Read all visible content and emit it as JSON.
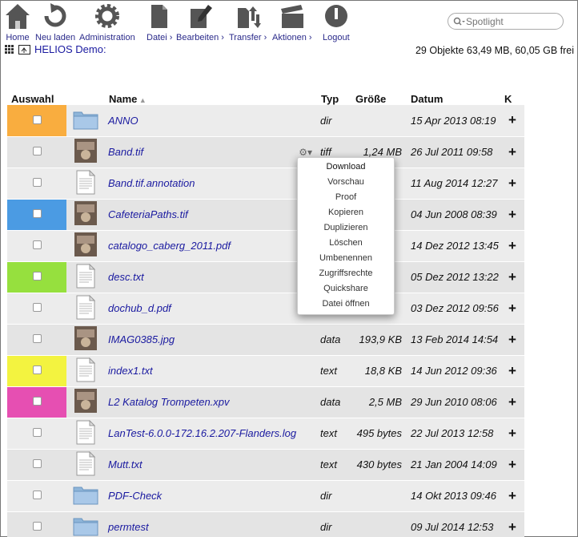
{
  "toolbar": {
    "home": "Home",
    "reload": "Neu laden",
    "admin": "Administration",
    "file": "Datei ›",
    "edit": "Bearbeiten ›",
    "transfer": "Transfer ›",
    "actions": "Aktionen ›",
    "logout": "Logout",
    "spotlight_placeholder": "Spotlight"
  },
  "pathbar": {
    "path": "HELIOS Demo:",
    "info": "29 Objekte 63,49 MB, 60,05 GB frei"
  },
  "columns": {
    "select": "Auswahl",
    "name": "Name",
    "type": "Typ",
    "size": "Größe",
    "date": "Datum",
    "k": "K"
  },
  "files": [
    {
      "name": "ANNO",
      "type": "dir",
      "size": "",
      "date": "15 Apr 2013 08:19",
      "color": "#f9ad3f",
      "icon": "folder-icon"
    },
    {
      "name": "Band.tif",
      "type": "tiff",
      "size": "1,24 MB",
      "date": "26 Jul 2011 09:58",
      "color": "",
      "icon": "image-thumbnail"
    },
    {
      "name": "Band.tif.annotation",
      "type": "",
      "size": "",
      "date": "11 Aug 2014 12:27",
      "color": "",
      "icon": "document-icon"
    },
    {
      "name": "CafeteriaPaths.tif",
      "type": "",
      "size": "",
      "date": "04 Jun 2008 08:39",
      "color": "#4b9be3",
      "icon": "image-thumbnail"
    },
    {
      "name": "catalogo_caberg_2011.pdf",
      "type": "",
      "size": "",
      "date": "14 Dez 2012 13:45",
      "color": "",
      "icon": "image-thumbnail"
    },
    {
      "name": "desc.txt",
      "type": "",
      "size": "",
      "date": "05 Dez 2012 13:22",
      "color": "#96e03e",
      "icon": "document-icon"
    },
    {
      "name": "dochub_d.pdf",
      "type": "",
      "size": "",
      "date": "03 Dez 2012 09:56",
      "color": "",
      "icon": "document-icon"
    },
    {
      "name": "IMAG0385.jpg",
      "type": "data",
      "size": "193,9 KB",
      "date": "13 Feb 2014 14:54",
      "color": "",
      "icon": "image-thumbnail"
    },
    {
      "name": "index1.txt",
      "type": "text",
      "size": "18,8 KB",
      "date": "14 Jun 2012 09:36",
      "color": "#f3f340",
      "icon": "document-icon"
    },
    {
      "name": "L2 Katalog Trompeten.xpv",
      "type": "data",
      "size": "2,5 MB",
      "date": "29 Jun 2010 08:06",
      "color": "#e64fb2",
      "icon": "image-thumbnail"
    },
    {
      "name": "LanTest-6.0.0-172.16.2.207-Flanders.log",
      "type": "text",
      "size": "495 bytes",
      "date": "22 Jul 2013 12:58",
      "color": "",
      "icon": "document-icon"
    },
    {
      "name": "Mutt.txt",
      "type": "text",
      "size": "430 bytes",
      "date": "21 Jan 2004 14:09",
      "color": "",
      "icon": "document-icon"
    },
    {
      "name": "PDF-Check",
      "type": "dir",
      "size": "",
      "date": "14 Okt 2013 09:46",
      "color": "",
      "icon": "folder-icon"
    },
    {
      "name": "permtest",
      "type": "dir",
      "size": "",
      "date": "09 Jul 2014 12:53",
      "color": "",
      "icon": "folder-icon"
    }
  ],
  "context_menu": [
    "Download",
    "Vorschau",
    "Proof",
    "Kopieren",
    "Duplizieren",
    "Löschen",
    "Umbenennen",
    "Zugriffsrechte",
    "Quickshare",
    "Datei öffnen"
  ]
}
